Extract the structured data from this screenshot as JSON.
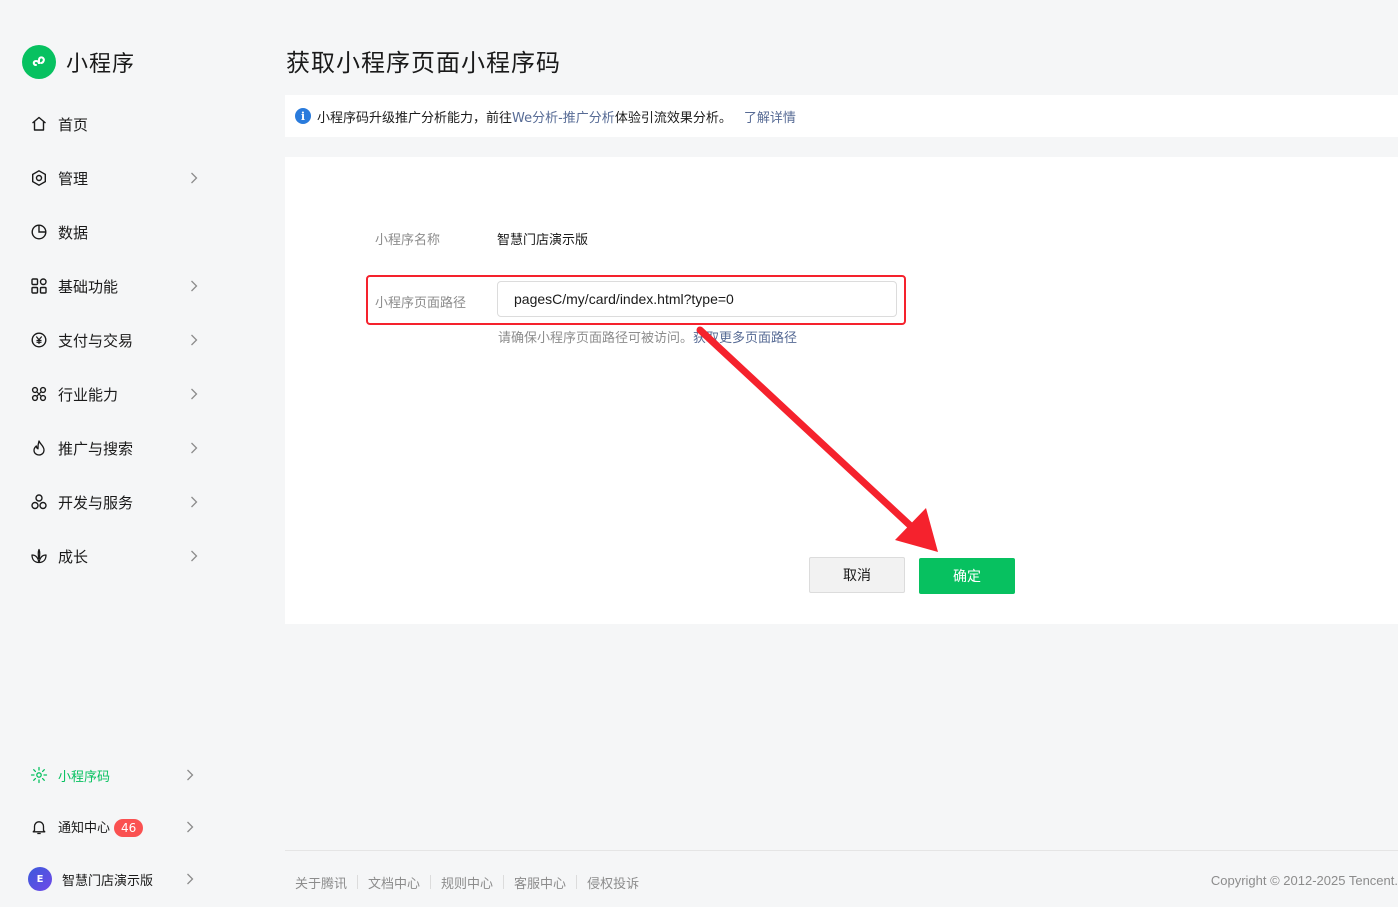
{
  "app": {
    "name": "小程序"
  },
  "sidebar": {
    "items": [
      {
        "label": "首页",
        "icon": "home-icon",
        "chevron": false
      },
      {
        "label": "管理",
        "icon": "settings-hex-icon",
        "chevron": true
      },
      {
        "label": "数据",
        "icon": "pie-chart-icon",
        "chevron": false
      },
      {
        "label": "基础功能",
        "icon": "grid-icon",
        "chevron": true
      },
      {
        "label": "支付与交易",
        "icon": "yuan-coin-icon",
        "chevron": true
      },
      {
        "label": "行业能力",
        "icon": "nodes-icon",
        "chevron": true
      },
      {
        "label": "推广与搜索",
        "icon": "flame-icon",
        "chevron": true
      },
      {
        "label": "开发与服务",
        "icon": "cluster-icon",
        "chevron": true
      },
      {
        "label": "成长",
        "icon": "leaf-icon",
        "chevron": true
      }
    ],
    "bottom": {
      "miniprogram_code": "小程序码",
      "notifications": "通知中心",
      "notification_count": "46",
      "account_name": "智慧门店演示版",
      "avatar_text": "E"
    }
  },
  "page": {
    "title": "获取小程序页面小程序码"
  },
  "notice": {
    "text_before": "小程序码升级推广分析能力，前往",
    "link": "We分析-推广分析",
    "text_after": "体验引流效果分析。",
    "more": "了解详情"
  },
  "form": {
    "name_label": "小程序名称",
    "name_value": "智慧门店演示版",
    "path_label": "小程序页面路径",
    "path_value": "pagesC/my/card/index.html?type=0",
    "hint_text": "请确保小程序页面路径可被访问。",
    "hint_link": "获取更多页面路径",
    "cancel": "取消",
    "confirm": "确定"
  },
  "footer": {
    "links": [
      "关于腾讯",
      "文档中心",
      "规则中心",
      "客服中心",
      "侵权投诉"
    ],
    "copyright": "Copyright © 2012-2025 Tencent."
  },
  "colors": {
    "brand": "#07c160",
    "link": "#576b95",
    "annotation": "#f5222d",
    "badge": "#fa5151"
  }
}
